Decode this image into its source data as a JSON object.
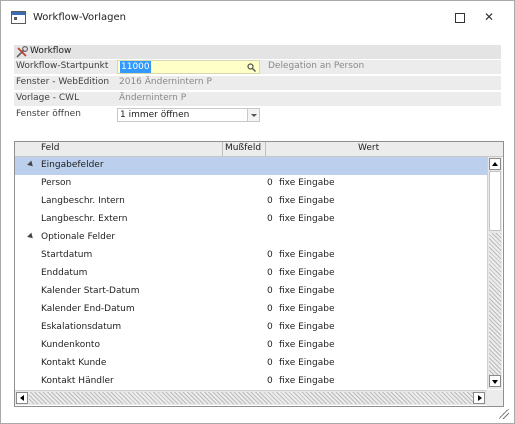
{
  "window": {
    "title": "Workflow-Vorlagen"
  },
  "form": {
    "header": "Workflow",
    "rows": [
      {
        "label": "Workflow-Startpunkt",
        "value": "11000",
        "extra": "Delegation an Person"
      },
      {
        "label": "Fenster - WebEdition",
        "value": "2016 Ändernintern  P"
      },
      {
        "label": "Vorlage - CWL",
        "value": "Ändernintern  P"
      },
      {
        "label": "Fenster öffnen",
        "value": "1 immer öffnen"
      }
    ]
  },
  "grid": {
    "columns": {
      "feld": "Feld",
      "muss": "Mußfeld",
      "wert": "Wert"
    },
    "rows": [
      {
        "type": "group",
        "label": "Eingabefelder"
      },
      {
        "type": "item",
        "feld": "Person",
        "muss": "0",
        "wert": "fixe Eingabe"
      },
      {
        "type": "item",
        "feld": "Langbeschr. Intern",
        "muss": "0",
        "wert": "fixe Eingabe"
      },
      {
        "type": "item",
        "feld": "Langbeschr. Extern",
        "muss": "0",
        "wert": "fixe Eingabe"
      },
      {
        "type": "group",
        "label": "Optionale Felder"
      },
      {
        "type": "item",
        "feld": "Startdatum",
        "muss": "0",
        "wert": "fixe Eingabe"
      },
      {
        "type": "item",
        "feld": "Enddatum",
        "muss": "0",
        "wert": "fixe Eingabe"
      },
      {
        "type": "item",
        "feld": "Kalender Start-Datum",
        "muss": "0",
        "wert": "fixe Eingabe"
      },
      {
        "type": "item",
        "feld": "Kalender End-Datum",
        "muss": "0",
        "wert": "fixe Eingabe"
      },
      {
        "type": "item",
        "feld": "Eskalationsdatum",
        "muss": "0",
        "wert": "fixe Eingabe"
      },
      {
        "type": "item",
        "feld": "Kundenkonto",
        "muss": "0",
        "wert": "fixe Eingabe"
      },
      {
        "type": "item",
        "feld": "Kontakt Kunde",
        "muss": "0",
        "wert": "fixe Eingabe"
      },
      {
        "type": "item",
        "feld": "Kontakt Händler",
        "muss": "0",
        "wert": "fixe Eingabe"
      }
    ]
  }
}
